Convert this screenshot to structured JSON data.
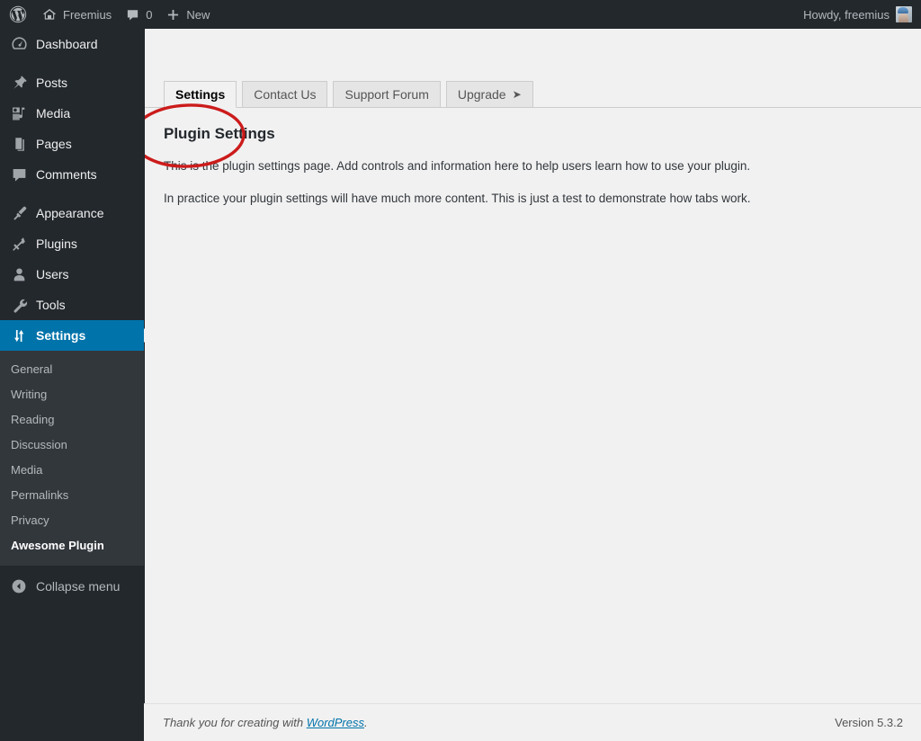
{
  "adminbar": {
    "logo_icon": "wordpress-logo-icon",
    "site_icon": "home-icon",
    "site_name": "Freemius",
    "comments_icon": "comment-bubble-icon",
    "comments_count": "0",
    "new_icon": "plus-icon",
    "new_label": "New",
    "howdy": "Howdy, freemius",
    "avatar": "user-avatar"
  },
  "sidebar": {
    "items": [
      {
        "label": "Dashboard",
        "icon": "dashboard-icon",
        "current": false
      },
      {
        "label": "Posts",
        "icon": "pin-icon",
        "current": false
      },
      {
        "label": "Media",
        "icon": "media-icon",
        "current": false
      },
      {
        "label": "Pages",
        "icon": "pages-icon",
        "current": false
      },
      {
        "label": "Comments",
        "icon": "comment-bubble-icon",
        "current": false
      },
      {
        "label": "Appearance",
        "icon": "paintbrush-icon",
        "current": false
      },
      {
        "label": "Plugins",
        "icon": "plug-icon",
        "current": false
      },
      {
        "label": "Users",
        "icon": "user-icon",
        "current": false
      },
      {
        "label": "Tools",
        "icon": "wrench-icon",
        "current": false
      },
      {
        "label": "Settings",
        "icon": "settings-sliders-icon",
        "current": true
      }
    ],
    "submenu": [
      {
        "label": "General",
        "current": false
      },
      {
        "label": "Writing",
        "current": false
      },
      {
        "label": "Reading",
        "current": false
      },
      {
        "label": "Discussion",
        "current": false
      },
      {
        "label": "Media",
        "current": false
      },
      {
        "label": "Permalinks",
        "current": false
      },
      {
        "label": "Privacy",
        "current": false
      },
      {
        "label": "Awesome Plugin",
        "current": true
      }
    ],
    "collapse": {
      "label": "Collapse menu",
      "icon": "collapse-arrow-left-icon"
    }
  },
  "tabs": [
    {
      "label": "Settings",
      "active": true,
      "arrow": ""
    },
    {
      "label": "Contact Us",
      "active": false,
      "arrow": ""
    },
    {
      "label": "Support Forum",
      "active": false,
      "arrow": ""
    },
    {
      "label": "Upgrade",
      "active": false,
      "arrow": "➤"
    }
  ],
  "main": {
    "title": "Plugin Settings",
    "paragraph_1": "This is the plugin settings page. Add controls and information here to help users learn how to use your plugin.",
    "paragraph_2": "In practice your plugin settings will have much more content. This is just a test to demonstrate how tabs work."
  },
  "annotation": {
    "shape": "red-ellipse-highlight",
    "color": "#cc1b1b",
    "target": "Settings"
  },
  "footer": {
    "thanks_prefix": "Thank you for creating with ",
    "link_label": "WordPress",
    "thanks_suffix": ".",
    "version": "Version 5.3.2"
  },
  "colors": {
    "adminbar_bg": "#23282d",
    "sidebar_bg": "#23282d",
    "submenu_bg": "#32373c",
    "accent": "#0073aa",
    "content_bg": "#f1f1f1",
    "tab_inactive_bg": "#e5e5e5",
    "annotation_red": "#cc1b1b"
  }
}
